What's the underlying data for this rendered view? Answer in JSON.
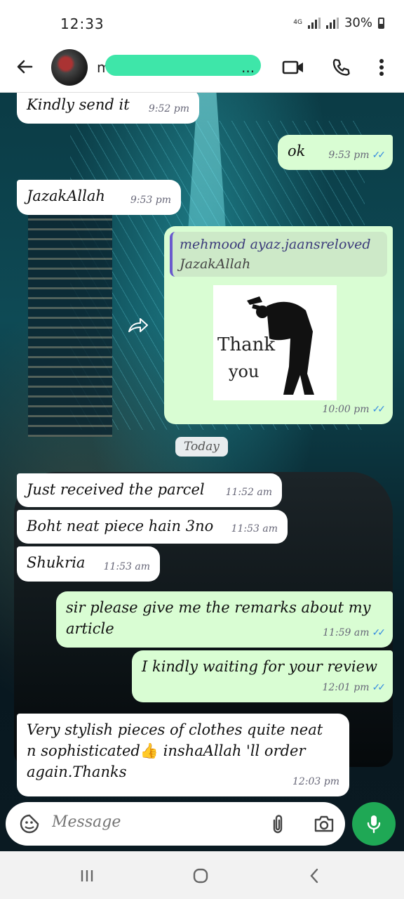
{
  "status_bar": {
    "time": "12:33",
    "network": "4G",
    "battery": "30%"
  },
  "header": {
    "contact_initial": "m",
    "contact_name_suffix": "..."
  },
  "messages": [
    {
      "dir": "in",
      "text": "Kindly send it",
      "time": "9:52 pm"
    },
    {
      "dir": "out",
      "text": "ok",
      "time": "9:53 pm"
    },
    {
      "dir": "in",
      "text": "JazakAllah",
      "time": "9:53 pm"
    },
    {
      "dir": "out",
      "quote_author": "mehmood ayaz.jaansreloved",
      "quote_text": "JazakAllah",
      "image_text_1": "Thank",
      "image_text_2": "you",
      "time": "10:00 pm"
    },
    {
      "dir": "in",
      "text": "Just received the parcel",
      "time": "11:52 am"
    },
    {
      "dir": "in",
      "text": "Boht neat piece hain 3no",
      "time": "11:53 am"
    },
    {
      "dir": "in",
      "text": "Shukria",
      "time": "11:53 am"
    },
    {
      "dir": "out",
      "text": "sir please give me the remarks about my article",
      "time": "11:59 am"
    },
    {
      "dir": "out",
      "text": "I kindly waiting for your review",
      "time": "12:01 pm"
    },
    {
      "dir": "in",
      "text_before_emoji": "Very stylish pieces of clothes quite neat n sophisticated",
      "emoji": "👍",
      "text_after_emoji": "inshaAllah 'll order again.Thanks",
      "time": "12:03 pm"
    }
  ],
  "date_divider": "Today",
  "input": {
    "placeholder": "Message"
  },
  "colors": {
    "outgoing": "#d9fdd3",
    "incoming": "#ffffff",
    "accent": "#1fa855",
    "read_tick": "#3a8fe0"
  }
}
